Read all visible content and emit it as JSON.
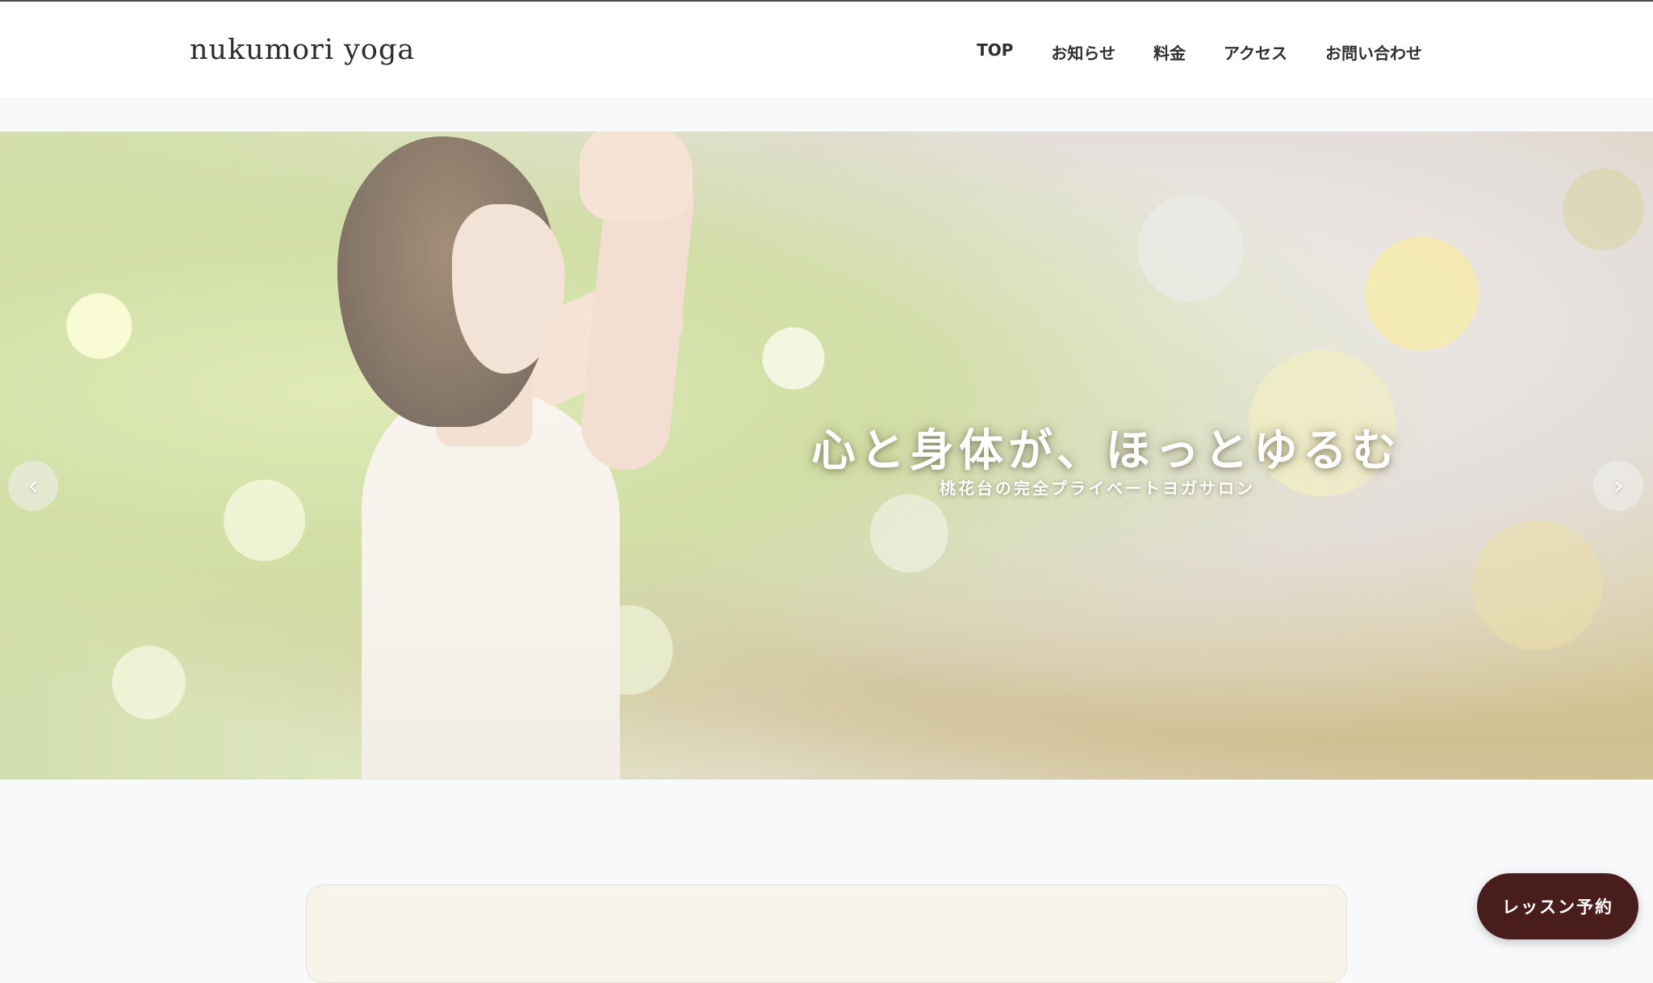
{
  "header": {
    "logo": "nukumori yoga",
    "nav": [
      {
        "label": "TOP"
      },
      {
        "label": "お知らせ"
      },
      {
        "label": "料金"
      },
      {
        "label": "アクセス"
      },
      {
        "label": "お問い合わせ"
      }
    ]
  },
  "hero": {
    "title": "心と身体が、ほっとゆるむ",
    "subtitle": "桃花台の完全プライベートヨガサロン",
    "prev_icon": "‹",
    "next_icon": "›"
  },
  "floating": {
    "reserve_label": "レッスン予約"
  },
  "colors": {
    "accent": "#4a1d1d",
    "card_background": "#f8f4ea",
    "page_background": "#f8f9fb"
  }
}
